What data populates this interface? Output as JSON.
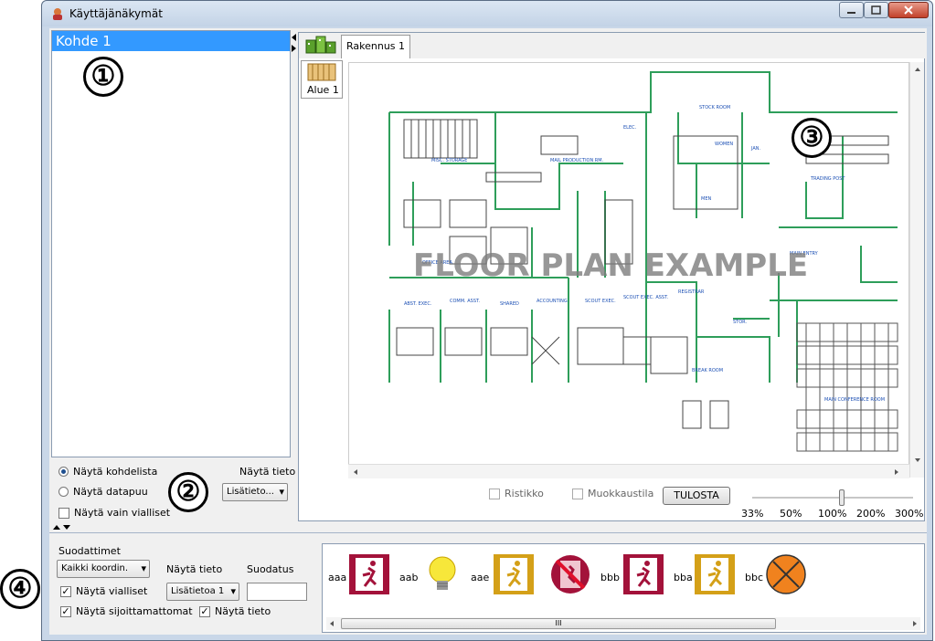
{
  "window": {
    "title": "Käyttäjänäkymät"
  },
  "badges": [
    "①",
    "②",
    "③",
    "④"
  ],
  "tree": {
    "selected_item": "Kohde 1"
  },
  "left_options": {
    "radio_kohdelista": "Näytä kohdelista",
    "radio_datapuu": "Näytä datapuu",
    "checkbox_vialliset": "Näytä vain vialliset",
    "nayta_tieto_label": "Näytä tieto",
    "nayta_tieto_value": "Lisätieto..."
  },
  "main": {
    "tab_label": "Rakennus 1",
    "side_tab_label": "Alue 1",
    "floor_plan_watermark": "FLOOR PLAN EXAMPLE",
    "plan_labels": {
      "stock_room": "STOCK ROOM",
      "stock_room_num": "130",
      "elec": "ELEC.",
      "elec_num": "138",
      "women": "WOMEN",
      "jan": "JAN.",
      "men": "MEN",
      "misc_storage": "MISC. STORAGE",
      "misc_storage_num": "125",
      "mail_production": "MAIL PRODUCTION RM.",
      "trading_post": "TRADING POST",
      "trading_post_num": "104",
      "access": "ACCESS",
      "main_entry": "MAIN ENTRY",
      "lobby": "LOBBY & CORRIDOR",
      "office_area": "OFFICE AREA",
      "abst_exec": "ABST. EXEC.",
      "comm_asst": "COMM. ASST.",
      "shared": "SHARED",
      "accounting": "ACCOUNTING",
      "scout_exec": "SCOUT EXEC.",
      "scout_exec_asst": "SCOUT EXEC. ASST.",
      "registrar": "REGISTRAR",
      "break_room": "BREAK ROOM",
      "storage": "STOR.",
      "main_conference": "MAIN CONFERENCE ROOM"
    },
    "ristikko_label": "Ristikko",
    "muokkaustila_label": "Muokkaustila",
    "tulosta_label": "TULOSTA",
    "zoom": {
      "value_percent": 100,
      "ticks": [
        "33%",
        "50%",
        "100%",
        "200%",
        "300%"
      ]
    }
  },
  "filters": {
    "group_label": "Suodattimet",
    "coord_combo": "Kaikki koordin.",
    "nayta_tieto_label": "Näytä tieto",
    "suodatus_label": "Suodatus",
    "show_faulty_label": "Näytä vialliset",
    "info_combo": "Lisätietoa 1",
    "show_unplaced_label": "Näytä sijoittamattomat",
    "show_info_label": "Näytä tieto",
    "suodatus_value": ""
  },
  "icons": [
    {
      "label": "aaa",
      "icon": "exit-red-icon"
    },
    {
      "label": "aab",
      "icon": "bulb-icon"
    },
    {
      "label": "aae",
      "icon": "exit-yellow-icon"
    },
    {
      "label": "",
      "icon": "exit-crossed-icon"
    },
    {
      "label": "bbb",
      "icon": "exit-red-icon"
    },
    {
      "label": "bba",
      "icon": "exit-yellow-icon"
    },
    {
      "label": "bbc",
      "icon": "lamp-x-icon"
    }
  ],
  "icon_scroll_grip": "III",
  "colors": {
    "selection": "#3399ff",
    "exit_red": "#a3123a",
    "exit_yellow": "#d4a018",
    "wall_green": "#2e9e5a",
    "plan_blue": "#1b4fb4",
    "lamp_orange": "#f0821e"
  }
}
